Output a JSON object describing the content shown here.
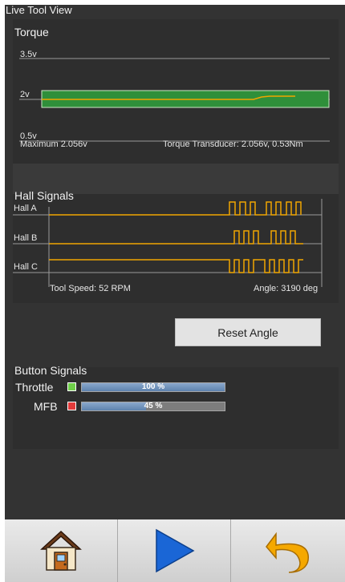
{
  "app": {
    "title": "Live Tool View"
  },
  "torque": {
    "label": "Torque",
    "scale_labels": [
      "3.5v",
      "2v",
      "0.5v"
    ],
    "maximum": "Maximum 2.056v",
    "transducer": "Torque Transducer: 2.056v,  0.53Nm",
    "colors": {
      "band": "#2f8f3a",
      "trace": "#f0a500",
      "band_border": "#cfe8c8"
    }
  },
  "hall": {
    "label": "Hall Signals",
    "channels": [
      "Hall A",
      "Hall B",
      "Hall C"
    ],
    "tool_speed": "Tool Speed: 52 RPM",
    "angle": "Angle:  3190 deg",
    "colors": {
      "trace": "#f0a500"
    }
  },
  "reset": {
    "label": "Reset Angle"
  },
  "buttons": {
    "label": "Button Signals",
    "throttle": {
      "label": "Throttle",
      "value": "100 %",
      "level": 1.0,
      "led_color": "#6fcf4a"
    },
    "mfb": {
      "label": "MFB",
      "value": "45 %",
      "level": 0.45,
      "led_color": "#e23b3b"
    }
  },
  "nav": {
    "icons": [
      "home-icon",
      "play-icon",
      "undo-icon"
    ]
  }
}
